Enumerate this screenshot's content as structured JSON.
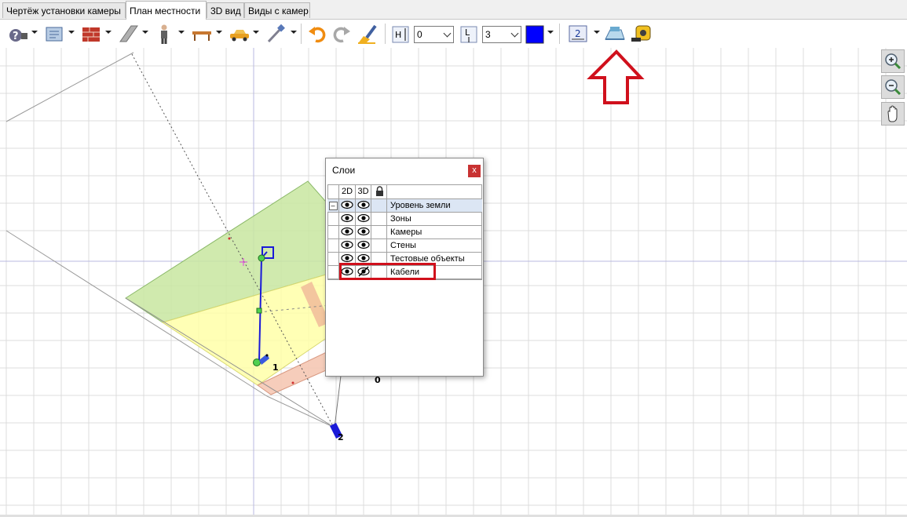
{
  "tabs": [
    {
      "label": "Чертёж установки камеры",
      "active": false
    },
    {
      "label": "План местности",
      "active": true
    },
    {
      "label": "3D вид",
      "active": false
    },
    {
      "label": "Виды с камер",
      "active": false
    }
  ],
  "toolbar": {
    "height_label": "H",
    "height_value": "0",
    "length_label": "L",
    "length_value": "3",
    "color": "#0000ff",
    "layer_button_value": "2"
  },
  "layers_dialog": {
    "title": "Слои",
    "close_label": "x",
    "columns": [
      "2D",
      "3D",
      "🔒",
      ""
    ],
    "collapse_label": "–",
    "layers": [
      {
        "name": "Уровень земли",
        "visible_2d": true,
        "visible_3d": true
      },
      {
        "name": "Зоны",
        "visible_2d": true,
        "visible_3d": true
      },
      {
        "name": "Камеры",
        "visible_2d": true,
        "visible_3d": true
      },
      {
        "name": "Стены",
        "visible_2d": true,
        "visible_3d": true
      },
      {
        "name": "Тестовые объекты",
        "visible_2d": true,
        "visible_3d": true
      },
      {
        "name": "Кабели",
        "visible_2d": true,
        "visible_3d": false
      }
    ]
  },
  "canvas": {
    "camera_label_1": "1",
    "camera_label_2": "2",
    "origin_label": "0"
  },
  "colors": {
    "annotation_red": "#d0101c",
    "cable_blue": "#1a1ad8",
    "zone_green": "#c8e6a0",
    "zone_yellow": "#ffffa8",
    "zone_pink": "#f5c8b4"
  }
}
